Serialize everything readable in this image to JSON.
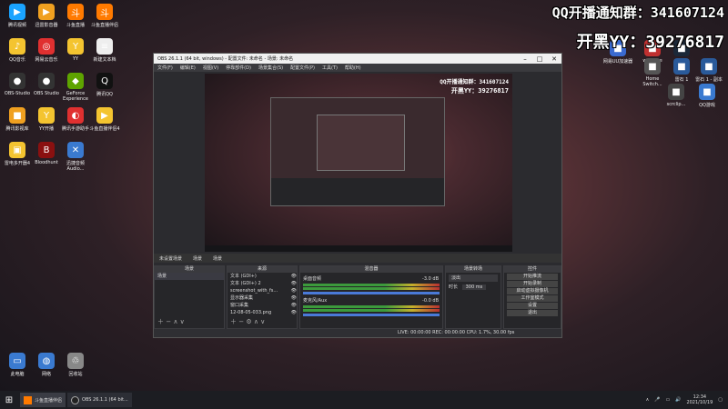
{
  "overlay": {
    "line1": "QQ开播通知群：341607124",
    "line2": "开黑YY：39276817"
  },
  "desktop_left": [
    {
      "label": "腾讯视频",
      "color": "#1aa3ff",
      "glyph": "▶"
    },
    {
      "label": "迅雷影音器",
      "color": "#f0a020",
      "glyph": "▶"
    },
    {
      "label": "斗鱼直播",
      "color": "#ff7a00",
      "glyph": "斗"
    },
    {
      "label": "斗鱼直播伴侣",
      "color": "#ff7a00",
      "glyph": "斗"
    },
    {
      "label": "QQ音乐",
      "color": "#f4c430",
      "glyph": "♪"
    },
    {
      "label": "网易云音乐",
      "color": "#e03030",
      "glyph": "◎"
    },
    {
      "label": "YY",
      "color": "#f4c430",
      "glyph": "Y"
    },
    {
      "label": "新建文本档",
      "color": "#eeeeee",
      "glyph": "≡"
    },
    {
      "label": "OBS-Studio",
      "color": "#333333",
      "glyph": "●"
    },
    {
      "label": "OBS Studio",
      "color": "#333333",
      "glyph": "●"
    },
    {
      "label": "GeForce Experience",
      "color": "#5ea400",
      "glyph": "◆"
    },
    {
      "label": "腾讯QQ",
      "color": "#111111",
      "glyph": "Q"
    },
    {
      "label": "腾讯影视库",
      "color": "#f0a020",
      "glyph": "■"
    },
    {
      "label": "YY开播",
      "color": "#f4c430",
      "glyph": "Y"
    },
    {
      "label": "腾讯手游助手",
      "color": "#e03030",
      "glyph": "◐"
    },
    {
      "label": "斗鱼直播伴侣4",
      "color": "#f4c430",
      "glyph": "▶"
    },
    {
      "label": "雷电多开器4",
      "color": "#f4c430",
      "glyph": "▣"
    },
    {
      "label": "Bloodhunt",
      "color": "#8a1010",
      "glyph": "B"
    },
    {
      "label": "迅捷音频 Audio...",
      "color": "#3a7ad0",
      "glyph": "✕"
    }
  ],
  "desktop_bottom": [
    {
      "label": "此电脑"
    },
    {
      "label": "网络"
    },
    {
      "label": "回收站"
    }
  ],
  "desktop_right": [
    {
      "label": "网易UU加速器"
    },
    {
      "label": "wegame"
    },
    {
      "label": "steam"
    },
    {
      "label": "Home Switch..."
    },
    {
      "label": "雷石 1"
    },
    {
      "label": "雷石 1 - 副本"
    },
    {
      "label": "scrclip..."
    },
    {
      "label": "QQ游戏"
    }
  ],
  "obs": {
    "title": "OBS 26.1.1 (64 bit, windows) - 配置文件: 未命名 - 场景: 未命名",
    "menus": [
      "文件(F)",
      "编辑(E)",
      "视图(V)",
      "停靠部件(D)",
      "场景集合(S)",
      "配置文件(P)",
      "工具(T)",
      "帮助(H)"
    ],
    "scene_tabs": [
      "未设置场景",
      "场景",
      "场景"
    ],
    "docks": {
      "scenes": {
        "title": "场景",
        "items": [
          "场景"
        ]
      },
      "sources": {
        "title": "来源",
        "items": [
          "文本 (GDI+)",
          "文本 (GDI+) 2",
          "screenshot_with_fs...",
          "显示器采集",
          "窗口采集",
          "12-08-05-033.png"
        ]
      },
      "mixer": {
        "title": "混音器",
        "tracks": [
          {
            "name": "桌面音频",
            "db": "-3.0 dB"
          },
          {
            "name": "麦克风/Aux",
            "db": "-0.0 dB"
          }
        ]
      },
      "transitions": {
        "title": "场景转场",
        "type": "淡出",
        "duration_label": "时长",
        "duration": "300 ms"
      },
      "controls": {
        "title": "控件",
        "buttons": [
          "开始推流",
          "开始录制",
          "启动虚拟摄像机",
          "工作室模式",
          "设置",
          "退出"
        ]
      }
    },
    "status": "LIVE: 00:00:00   REC: 00:00:00   CPU: 1.7%, 30.00 fps"
  },
  "taskbar": {
    "items": [
      {
        "label": "斗鱼直播伴侣"
      },
      {
        "label": "OBS 26.1.1 (64 bit..."
      }
    ],
    "time": "12:34",
    "date": "2021/10/19"
  }
}
